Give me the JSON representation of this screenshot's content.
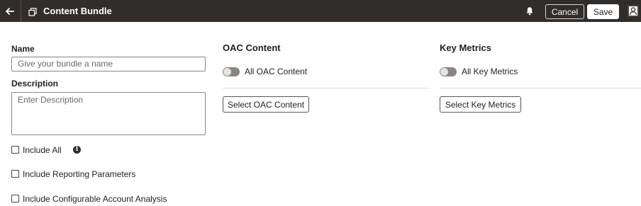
{
  "header": {
    "title": "Content Bundle",
    "back_icon": "back-arrow-icon",
    "bundle_icon": "bundle-icon",
    "bell_icon": "bell-icon",
    "profile_icon": "user-profile-icon",
    "cancel_label": "Cancel",
    "save_label": "Save",
    "bar_color": "#312d2a"
  },
  "form": {
    "name_label": "Name",
    "name_placeholder": "Give your bundle a name",
    "name_value": "",
    "description_label": "Description",
    "description_placeholder": "Enter Description",
    "description_value": "",
    "checkboxes": [
      {
        "label": "Include All",
        "checked": false,
        "info_icon": "info-icon"
      },
      {
        "label": "Include Reporting Parameters",
        "checked": false
      },
      {
        "label": "Include Configurable Account Analysis",
        "checked": false
      }
    ]
  },
  "oac": {
    "title": "OAC Content",
    "toggle_label": "All OAC Content",
    "toggle_on": false,
    "button_label": "Select OAC Content"
  },
  "metrics": {
    "title": "Key Metrics",
    "toggle_label": "All Key Metrics",
    "toggle_on": false,
    "button_label": "Select Key Metrics"
  }
}
